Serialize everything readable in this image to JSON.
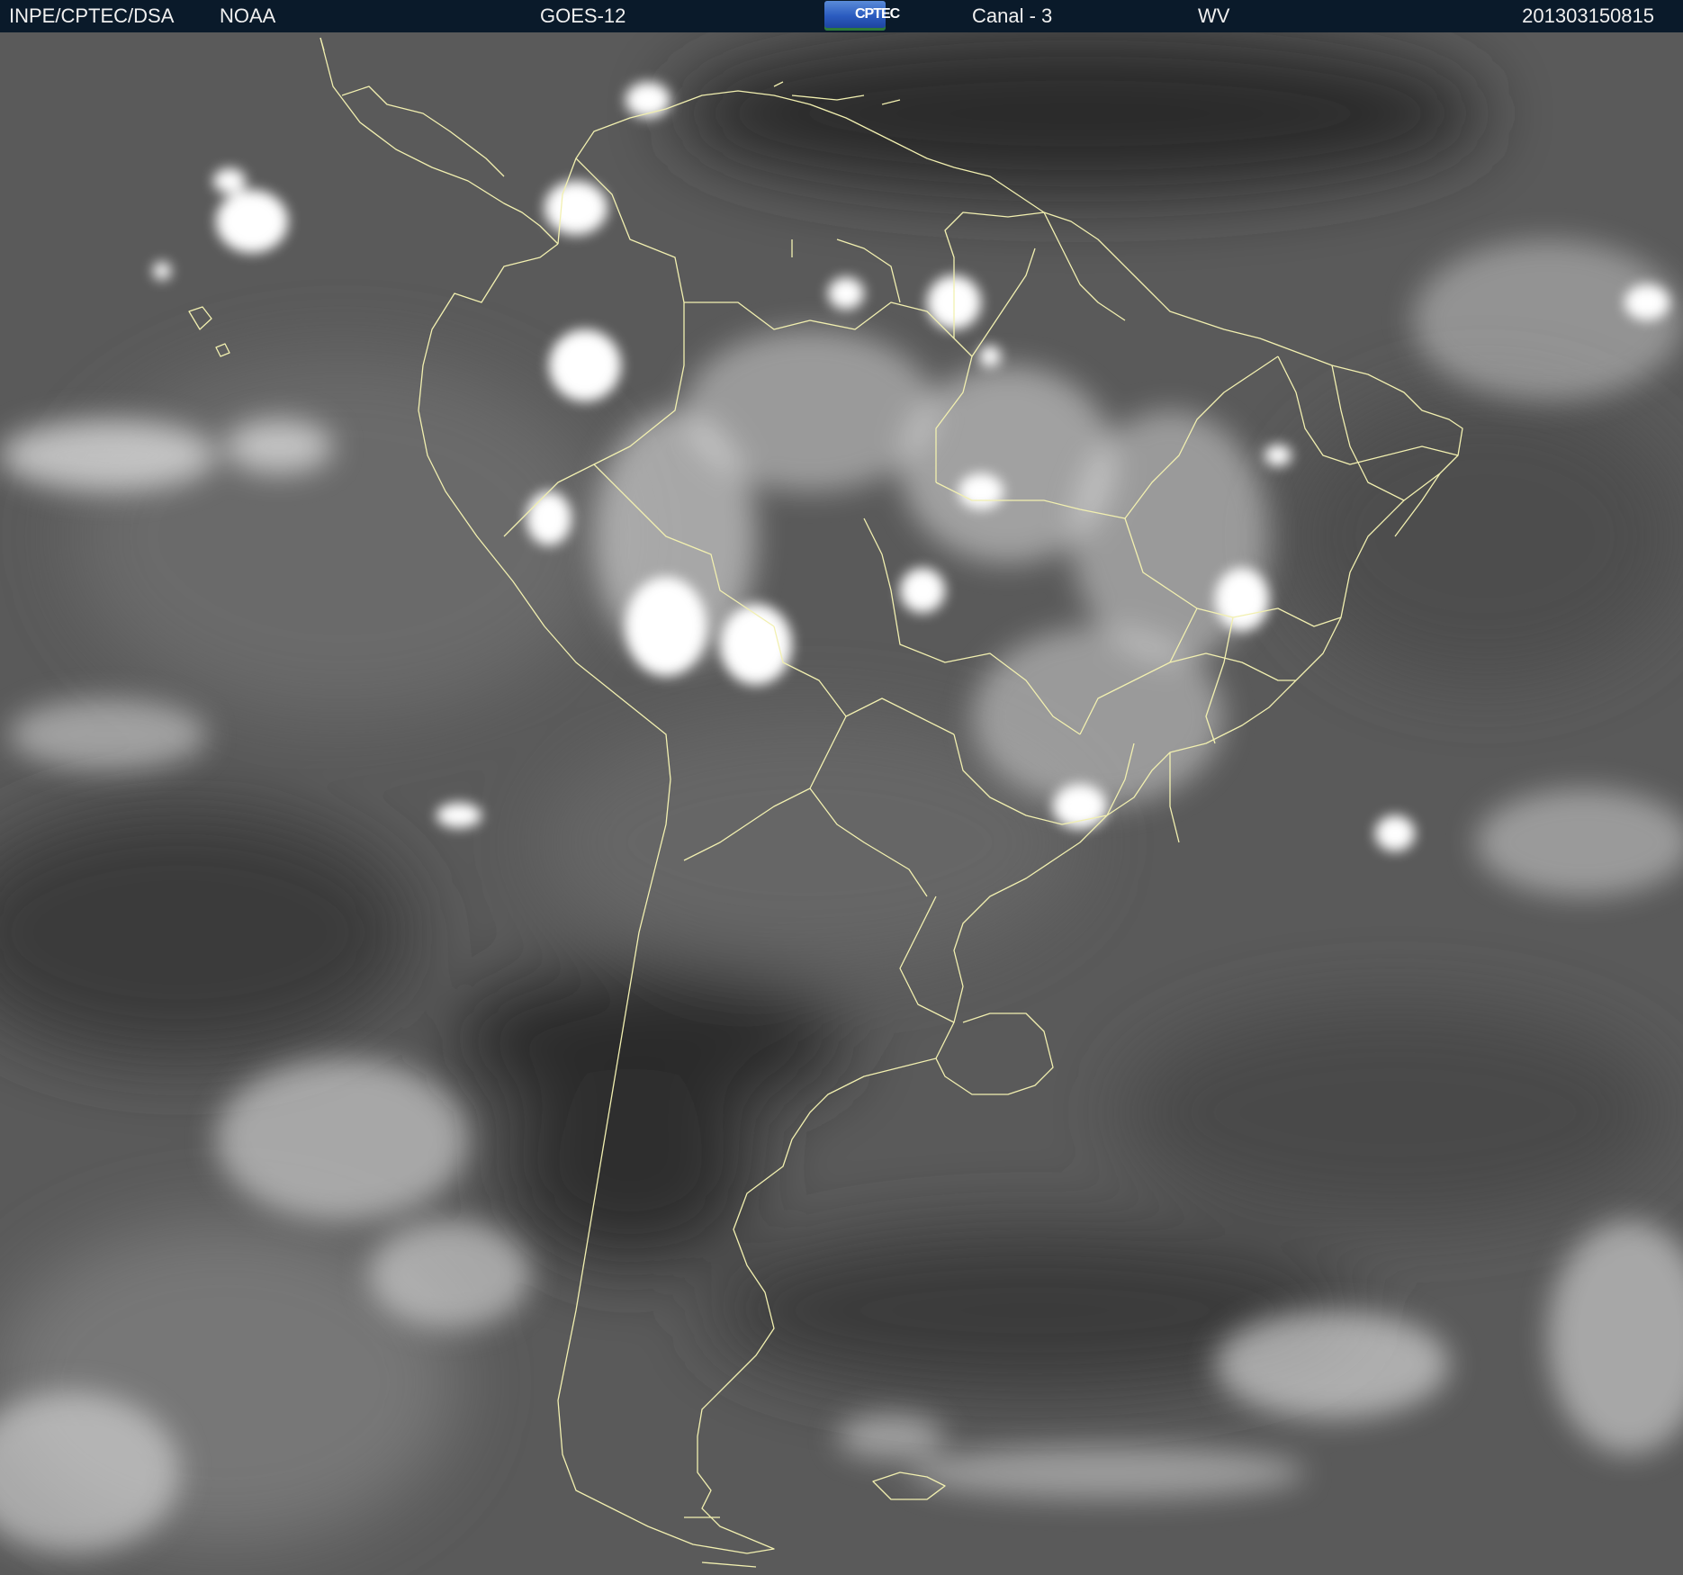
{
  "header": {
    "organization": "INPE/CPTEC/DSA",
    "agency": "NOAA",
    "satellite": "GOES-12",
    "logo_text": "CPTEC",
    "channel": "Canal - 3",
    "band": "WV",
    "timestamp": "201303150815"
  },
  "colors": {
    "header_background": "#0a1a2a",
    "header_text": "#f0f0f0",
    "border_lines": "#f2f0b0",
    "clouds": "#ffffff"
  },
  "icons": {
    "logo": "cptec-logo-icon"
  }
}
